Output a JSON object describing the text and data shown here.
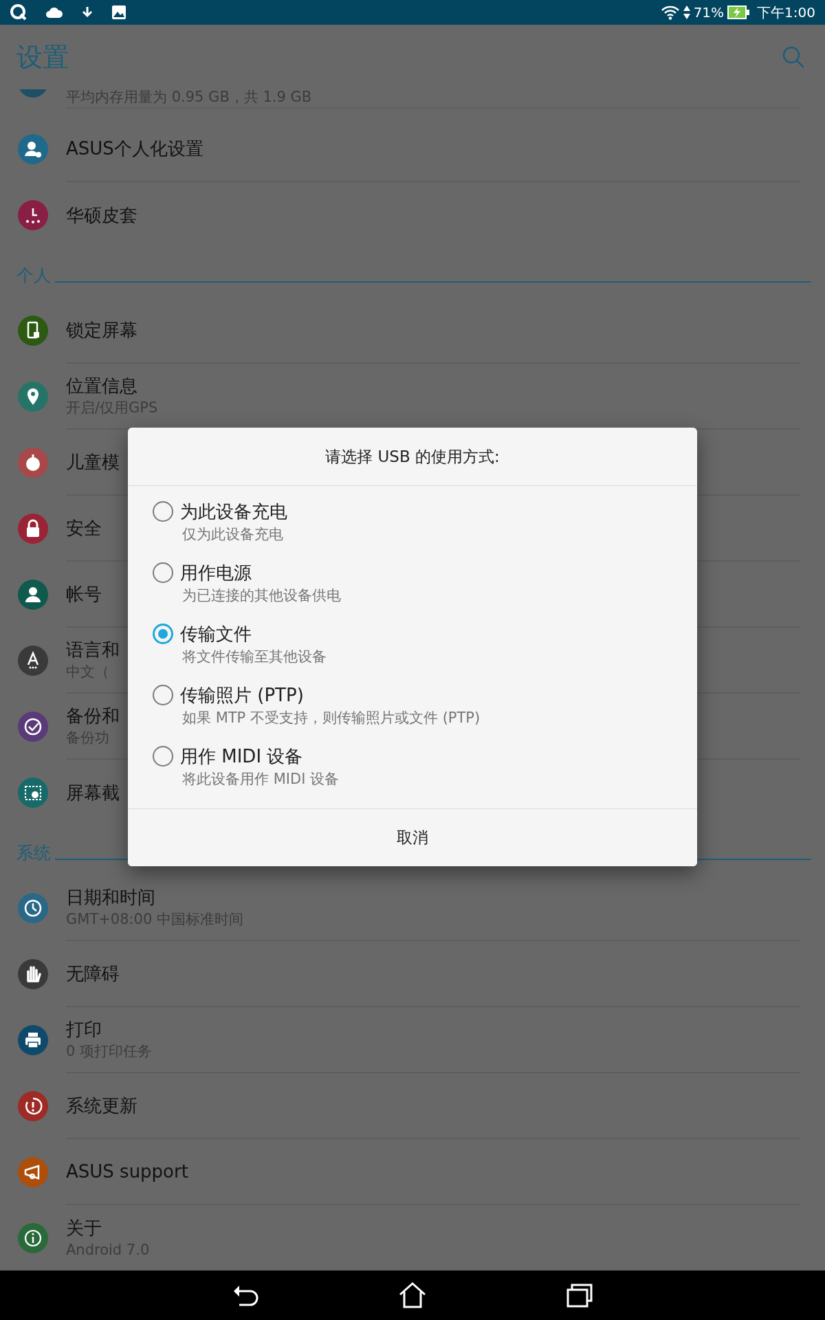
{
  "status_bar": {
    "battery": "71%",
    "time": "下午1:00"
  },
  "app_bar": {
    "title": "设置"
  },
  "list": [
    {
      "kind": "partial",
      "subtitle": "平均内存用量为 0.95 GB，共 1.9 GB",
      "color": "#1f4f66"
    },
    {
      "kind": "row",
      "title": "ASUS个人化设置",
      "color": "#1f6a8a"
    },
    {
      "kind": "row",
      "title": "华硕皮套",
      "color": "#8a1f45",
      "divider": false
    },
    {
      "kind": "header",
      "title": "个人"
    },
    {
      "kind": "row",
      "title": "锁定屏幕",
      "color": "#2c5a12"
    },
    {
      "kind": "row",
      "title": "位置信息",
      "subtitle": "开启/仅用GPS",
      "color": "#257468"
    },
    {
      "kind": "row",
      "title": "儿童模",
      "color": "#a8484a"
    },
    {
      "kind": "row",
      "title": "安全",
      "color": "#9a2335"
    },
    {
      "kind": "row",
      "title": "帐号",
      "color": "#0f5a4c"
    },
    {
      "kind": "row",
      "title": "语言和",
      "subtitle": "中文（",
      "color": "#3a3a3a"
    },
    {
      "kind": "row",
      "title": "备份和",
      "subtitle": "备份功",
      "color": "#5a3a78"
    },
    {
      "kind": "row",
      "title": "屏幕截",
      "color": "#186a6a",
      "divider": false
    },
    {
      "kind": "header",
      "title": "系统"
    },
    {
      "kind": "row",
      "title": "日期和时间",
      "subtitle": "GMT+08:00 中国标准时间",
      "color": "#2a6888"
    },
    {
      "kind": "row",
      "title": "无障碍",
      "color": "#3a3a3a"
    },
    {
      "kind": "row",
      "title": "打印",
      "subtitle": "0 项打印任务",
      "color": "#0f4a6a"
    },
    {
      "kind": "row",
      "title": "系统更新",
      "color": "#9e2b25"
    },
    {
      "kind": "row",
      "title": "ASUS support",
      "color": "#ad4e0a"
    },
    {
      "kind": "row",
      "title": "关于",
      "subtitle": "Android 7.0",
      "color": "#2a6a3a",
      "divider": false
    }
  ],
  "dialog": {
    "title": "请选择 USB 的使用方式:",
    "options": [
      {
        "label": "为此设备充电",
        "description": "仅为此设备充电",
        "selected": false
      },
      {
        "label": "用作电源",
        "description": "为已连接的其他设备供电",
        "selected": false
      },
      {
        "label": "传输文件",
        "description": "将文件传输至其他设备",
        "selected": true
      },
      {
        "label": "传输照片 (PTP)",
        "description": "如果 MTP 不受支持，则传输照片或文件 (PTP)",
        "selected": false
      },
      {
        "label": "用作 MIDI 设备",
        "description": "将此设备用作 MIDI 设备",
        "selected": false
      }
    ],
    "cancel": "取消"
  }
}
